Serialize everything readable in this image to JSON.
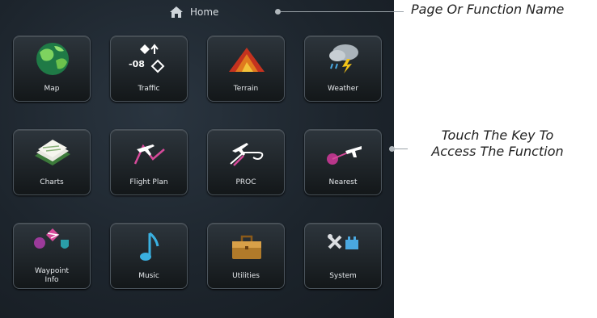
{
  "header": {
    "title": "Home",
    "icon": "home-icon"
  },
  "keys": [
    {
      "label": "Map",
      "icon": "map-icon"
    },
    {
      "label": "Traffic",
      "icon": "traffic-icon",
      "traffic_value": "-08"
    },
    {
      "label": "Terrain",
      "icon": "terrain-icon"
    },
    {
      "label": "Weather",
      "icon": "weather-icon"
    },
    {
      "label": "Charts",
      "icon": "charts-icon"
    },
    {
      "label": "Flight Plan",
      "icon": "flight-plan-icon"
    },
    {
      "label": "PROC",
      "icon": "proc-icon"
    },
    {
      "label": "Nearest",
      "icon": "nearest-icon"
    },
    {
      "label": "Waypoint",
      "label2": "Info",
      "icon": "waypoint-info-icon"
    },
    {
      "label": "Music",
      "icon": "music-icon"
    },
    {
      "label": "Utilities",
      "icon": "utilities-icon"
    },
    {
      "label": "System",
      "icon": "system-icon"
    }
  ],
  "callouts": {
    "page_name": "Page Or Function Name",
    "touch_line1": "Touch The Key To",
    "touch_line2": "Access The Function"
  }
}
